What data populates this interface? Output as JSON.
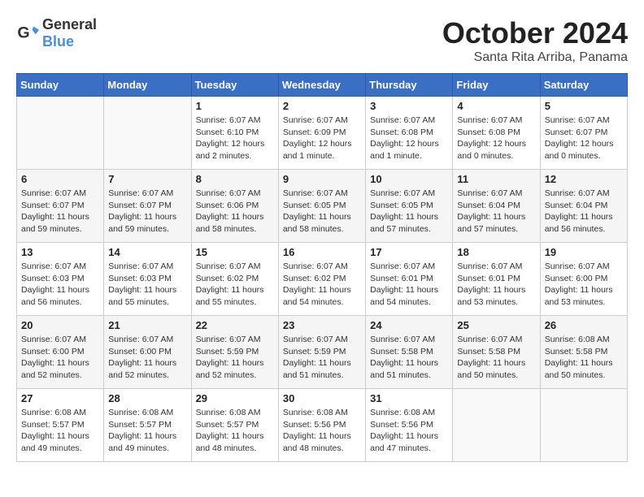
{
  "logo": {
    "general": "General",
    "blue": "Blue"
  },
  "title": "October 2024",
  "location": "Santa Rita Arriba, Panama",
  "weekdays": [
    "Sunday",
    "Monday",
    "Tuesday",
    "Wednesday",
    "Thursday",
    "Friday",
    "Saturday"
  ],
  "weeks": [
    [
      {
        "day": "",
        "empty": true
      },
      {
        "day": "",
        "empty": true
      },
      {
        "day": "1",
        "sunrise": "Sunrise: 6:07 AM",
        "sunset": "Sunset: 6:10 PM",
        "daylight": "Daylight: 12 hours and 2 minutes."
      },
      {
        "day": "2",
        "sunrise": "Sunrise: 6:07 AM",
        "sunset": "Sunset: 6:09 PM",
        "daylight": "Daylight: 12 hours and 1 minute."
      },
      {
        "day": "3",
        "sunrise": "Sunrise: 6:07 AM",
        "sunset": "Sunset: 6:08 PM",
        "daylight": "Daylight: 12 hours and 1 minute."
      },
      {
        "day": "4",
        "sunrise": "Sunrise: 6:07 AM",
        "sunset": "Sunset: 6:08 PM",
        "daylight": "Daylight: 12 hours and 0 minutes."
      },
      {
        "day": "5",
        "sunrise": "Sunrise: 6:07 AM",
        "sunset": "Sunset: 6:07 PM",
        "daylight": "Daylight: 12 hours and 0 minutes."
      }
    ],
    [
      {
        "day": "6",
        "sunrise": "Sunrise: 6:07 AM",
        "sunset": "Sunset: 6:07 PM",
        "daylight": "Daylight: 11 hours and 59 minutes."
      },
      {
        "day": "7",
        "sunrise": "Sunrise: 6:07 AM",
        "sunset": "Sunset: 6:07 PM",
        "daylight": "Daylight: 11 hours and 59 minutes."
      },
      {
        "day": "8",
        "sunrise": "Sunrise: 6:07 AM",
        "sunset": "Sunset: 6:06 PM",
        "daylight": "Daylight: 11 hours and 58 minutes."
      },
      {
        "day": "9",
        "sunrise": "Sunrise: 6:07 AM",
        "sunset": "Sunset: 6:05 PM",
        "daylight": "Daylight: 11 hours and 58 minutes."
      },
      {
        "day": "10",
        "sunrise": "Sunrise: 6:07 AM",
        "sunset": "Sunset: 6:05 PM",
        "daylight": "Daylight: 11 hours and 57 minutes."
      },
      {
        "day": "11",
        "sunrise": "Sunrise: 6:07 AM",
        "sunset": "Sunset: 6:04 PM",
        "daylight": "Daylight: 11 hours and 57 minutes."
      },
      {
        "day": "12",
        "sunrise": "Sunrise: 6:07 AM",
        "sunset": "Sunset: 6:04 PM",
        "daylight": "Daylight: 11 hours and 56 minutes."
      }
    ],
    [
      {
        "day": "13",
        "sunrise": "Sunrise: 6:07 AM",
        "sunset": "Sunset: 6:03 PM",
        "daylight": "Daylight: 11 hours and 56 minutes."
      },
      {
        "day": "14",
        "sunrise": "Sunrise: 6:07 AM",
        "sunset": "Sunset: 6:03 PM",
        "daylight": "Daylight: 11 hours and 55 minutes."
      },
      {
        "day": "15",
        "sunrise": "Sunrise: 6:07 AM",
        "sunset": "Sunset: 6:02 PM",
        "daylight": "Daylight: 11 hours and 55 minutes."
      },
      {
        "day": "16",
        "sunrise": "Sunrise: 6:07 AM",
        "sunset": "Sunset: 6:02 PM",
        "daylight": "Daylight: 11 hours and 54 minutes."
      },
      {
        "day": "17",
        "sunrise": "Sunrise: 6:07 AM",
        "sunset": "Sunset: 6:01 PM",
        "daylight": "Daylight: 11 hours and 54 minutes."
      },
      {
        "day": "18",
        "sunrise": "Sunrise: 6:07 AM",
        "sunset": "Sunset: 6:01 PM",
        "daylight": "Daylight: 11 hours and 53 minutes."
      },
      {
        "day": "19",
        "sunrise": "Sunrise: 6:07 AM",
        "sunset": "Sunset: 6:00 PM",
        "daylight": "Daylight: 11 hours and 53 minutes."
      }
    ],
    [
      {
        "day": "20",
        "sunrise": "Sunrise: 6:07 AM",
        "sunset": "Sunset: 6:00 PM",
        "daylight": "Daylight: 11 hours and 52 minutes."
      },
      {
        "day": "21",
        "sunrise": "Sunrise: 6:07 AM",
        "sunset": "Sunset: 6:00 PM",
        "daylight": "Daylight: 11 hours and 52 minutes."
      },
      {
        "day": "22",
        "sunrise": "Sunrise: 6:07 AM",
        "sunset": "Sunset: 5:59 PM",
        "daylight": "Daylight: 11 hours and 52 minutes."
      },
      {
        "day": "23",
        "sunrise": "Sunrise: 6:07 AM",
        "sunset": "Sunset: 5:59 PM",
        "daylight": "Daylight: 11 hours and 51 minutes."
      },
      {
        "day": "24",
        "sunrise": "Sunrise: 6:07 AM",
        "sunset": "Sunset: 5:58 PM",
        "daylight": "Daylight: 11 hours and 51 minutes."
      },
      {
        "day": "25",
        "sunrise": "Sunrise: 6:07 AM",
        "sunset": "Sunset: 5:58 PM",
        "daylight": "Daylight: 11 hours and 50 minutes."
      },
      {
        "day": "26",
        "sunrise": "Sunrise: 6:08 AM",
        "sunset": "Sunset: 5:58 PM",
        "daylight": "Daylight: 11 hours and 50 minutes."
      }
    ],
    [
      {
        "day": "27",
        "sunrise": "Sunrise: 6:08 AM",
        "sunset": "Sunset: 5:57 PM",
        "daylight": "Daylight: 11 hours and 49 minutes."
      },
      {
        "day": "28",
        "sunrise": "Sunrise: 6:08 AM",
        "sunset": "Sunset: 5:57 PM",
        "daylight": "Daylight: 11 hours and 49 minutes."
      },
      {
        "day": "29",
        "sunrise": "Sunrise: 6:08 AM",
        "sunset": "Sunset: 5:57 PM",
        "daylight": "Daylight: 11 hours and 48 minutes."
      },
      {
        "day": "30",
        "sunrise": "Sunrise: 6:08 AM",
        "sunset": "Sunset: 5:56 PM",
        "daylight": "Daylight: 11 hours and 48 minutes."
      },
      {
        "day": "31",
        "sunrise": "Sunrise: 6:08 AM",
        "sunset": "Sunset: 5:56 PM",
        "daylight": "Daylight: 11 hours and 47 minutes."
      },
      {
        "day": "",
        "empty": true
      },
      {
        "day": "",
        "empty": true
      }
    ]
  ]
}
